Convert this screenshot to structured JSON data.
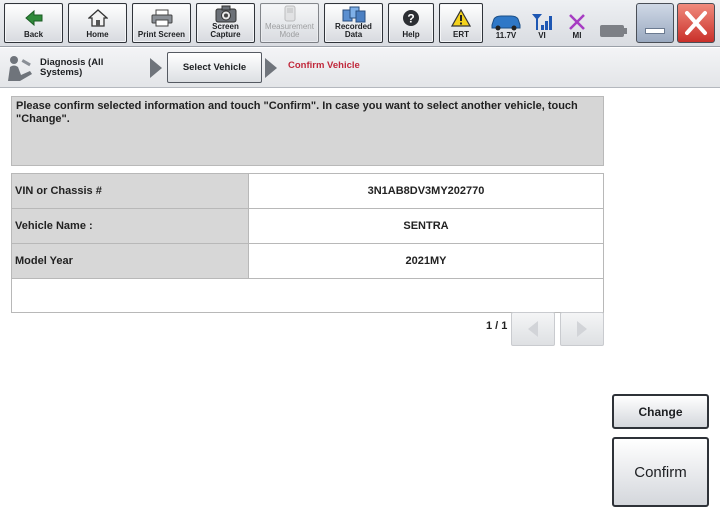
{
  "toolbar": {
    "buttons": [
      {
        "label": "Back",
        "icon": "back-arrow-icon"
      },
      {
        "label": "Home",
        "icon": "home-icon"
      },
      {
        "label": "Print Screen",
        "icon": "printer-icon"
      },
      {
        "label": "Screen Capture",
        "icon": "camera-icon"
      },
      {
        "label": "Measurement Mode",
        "icon": "measurement-icon"
      },
      {
        "label": "Recorded Data",
        "icon": "recorded-data-icon"
      },
      {
        "label": "Help",
        "icon": "help-icon"
      },
      {
        "label": "ERT",
        "icon": "warning-icon"
      }
    ],
    "status": {
      "battery_voltage": "11.7V",
      "vi_label": "VI",
      "mi_label": "MI"
    }
  },
  "breadcrumb": {
    "home_label": "Diagnosis (All Systems)",
    "select_vehicle_label": "Select Vehicle",
    "current_label": "Confirm Vehicle"
  },
  "message": "Please confirm selected information and touch \"Confirm\". In case you want to select another vehicle, touch \"Change\".",
  "vehicle_info": [
    {
      "label": "VIN or Chassis #",
      "value": "3N1AB8DV3MY202770"
    },
    {
      "label": "Vehicle Name :",
      "value": "SENTRA"
    },
    {
      "label": "Model Year",
      "value": "2021MY"
    }
  ],
  "pager": {
    "count": "1 / 1"
  },
  "actions": {
    "change_label": "Change",
    "confirm_label": "Confirm"
  },
  "colors": {
    "current_crumb": "#c0283b",
    "label_cell": "#d7d7d7",
    "message_bg": "#d6d6d6"
  }
}
